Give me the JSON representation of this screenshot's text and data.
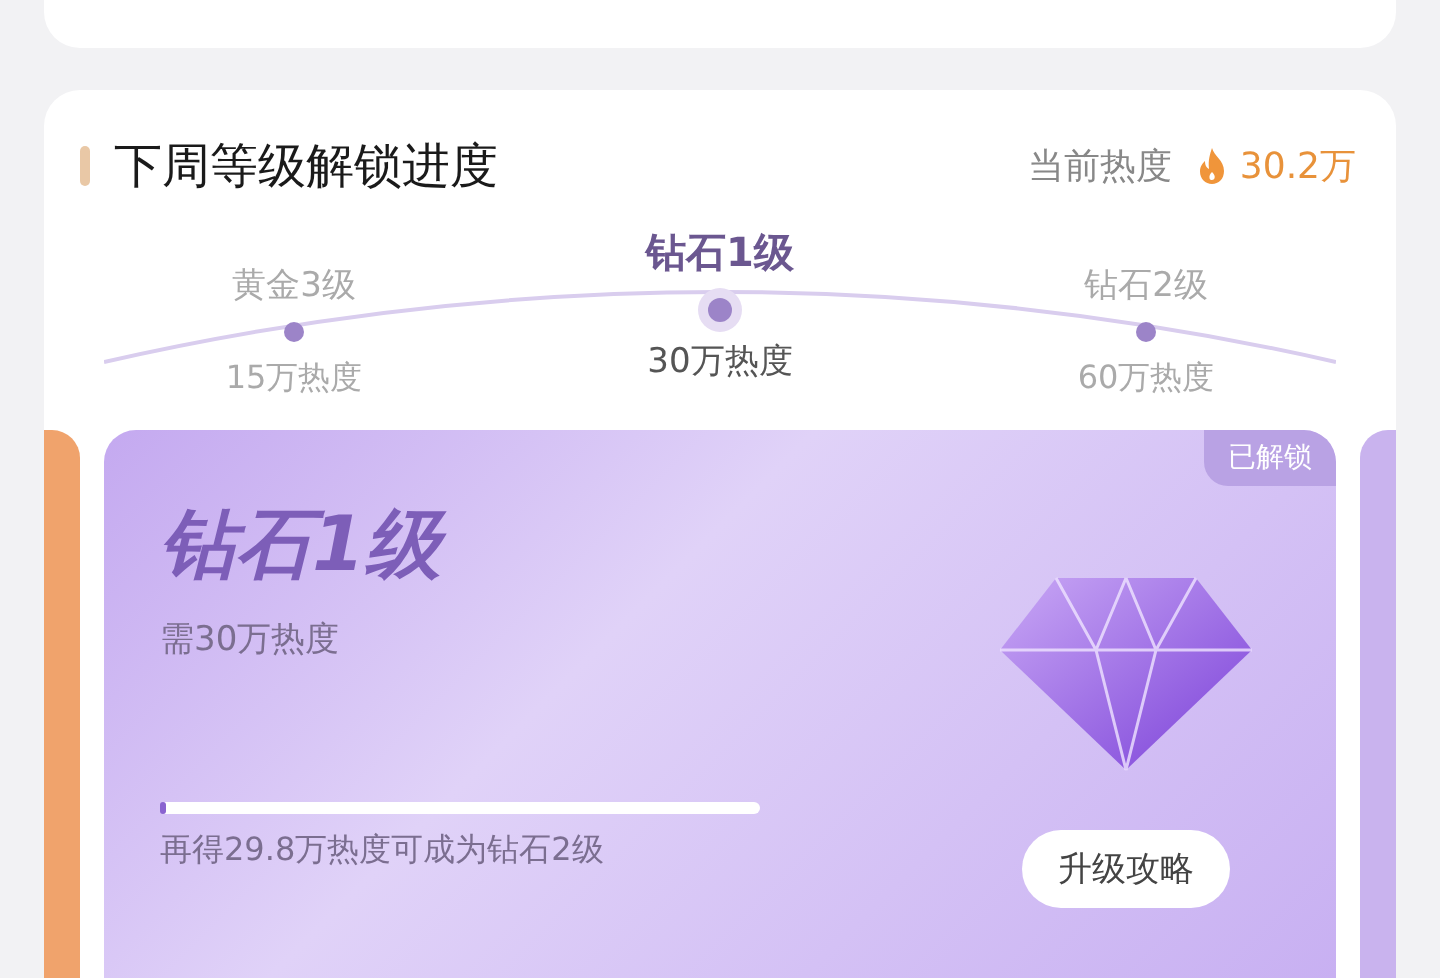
{
  "section": {
    "title": "下周等级解锁进度",
    "heat_label": "当前热度",
    "heat_value": "30.2万"
  },
  "milestones": [
    {
      "name": "黄金3级",
      "heat": "15万热度",
      "selected": false
    },
    {
      "name": "钻石1级",
      "heat": "30万热度",
      "selected": true
    },
    {
      "name": "钻石2级",
      "heat": "60万热度",
      "selected": false
    }
  ],
  "level_card": {
    "badge": "已解锁",
    "title": "钻石1级",
    "requirement": "需30万热度",
    "level": 0.01,
    "hint": "再得29.8万热度可成为钻石2级",
    "button": "升级攻略"
  }
}
